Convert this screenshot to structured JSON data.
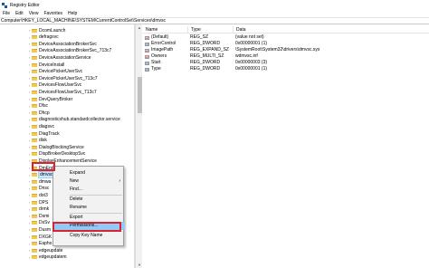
{
  "window": {
    "title": "Registry Editor"
  },
  "menu": [
    "File",
    "Edit",
    "View",
    "Favorites",
    "Help"
  ],
  "address": "Computer\\HKEY_LOCAL_MACHINE\\SYSTEM\\CurrentControlSet\\Services\\dmvsc",
  "tree": {
    "items": [
      "DcomLaunch",
      "defragsvc",
      "DeviceAssociationBrokerSvc",
      "DeviceAssociationBrokerSvc_713c7",
      "DeviceAssociationService",
      "DeviceInstall",
      "DevicePickerUserSvc",
      "DevicePickerUserSvc_713c7",
      "DevicesFlowUserSvc",
      "DevicesFlowUserSvc_713c7",
      "DevQueryBroker",
      "Dfsc",
      "Dhcp",
      "diagnosticshub.standardcollector.service",
      "diagsvc",
      "DiagTrack",
      "disk",
      "DialogBlockingService",
      "DispBrokerDesktopSvc",
      "DisplayEnhancementService",
      "DmEnrollmentSvc",
      "dmvsc",
      "dmwa",
      "Dnsc",
      "dot3",
      "DPS",
      "drmk",
      "Dsmi",
      "DsSv",
      "Dusm",
      "DXGK",
      "Eapho",
      "edgeupdate",
      "edgeupdatem"
    ]
  },
  "values": {
    "headers": [
      "Name",
      "Type",
      "Data"
    ],
    "rows": [
      {
        "name": "(Default)",
        "type": "REG_SZ",
        "data": "(value not set)",
        "icon": "ab"
      },
      {
        "name": "ErrorControl",
        "type": "REG_DWORD",
        "data": "0x00000001 (1)",
        "icon": "num"
      },
      {
        "name": "ImagePath",
        "type": "REG_EXPAND_SZ",
        "data": "\\SystemRoot\\System32\\drivers\\dmvsc.sys",
        "icon": "ab"
      },
      {
        "name": "Owners",
        "type": "REG_MULTI_SZ",
        "data": "wdmvsc.inf",
        "icon": "ab"
      },
      {
        "name": "Start",
        "type": "REG_DWORD",
        "data": "0x00000003 (3)",
        "icon": "num"
      },
      {
        "name": "Type",
        "type": "REG_DWORD",
        "data": "0x00000001 (1)",
        "icon": "num"
      }
    ]
  },
  "context_menu": {
    "items": [
      {
        "label": "Expand"
      },
      {
        "label": "New",
        "submenu": true
      },
      {
        "label": "Find..."
      },
      {
        "label": "Delete"
      },
      {
        "label": "Rename"
      },
      {
        "label": "Export"
      },
      {
        "label": "Permissions..."
      },
      {
        "label": "Copy Key Name"
      }
    ]
  }
}
